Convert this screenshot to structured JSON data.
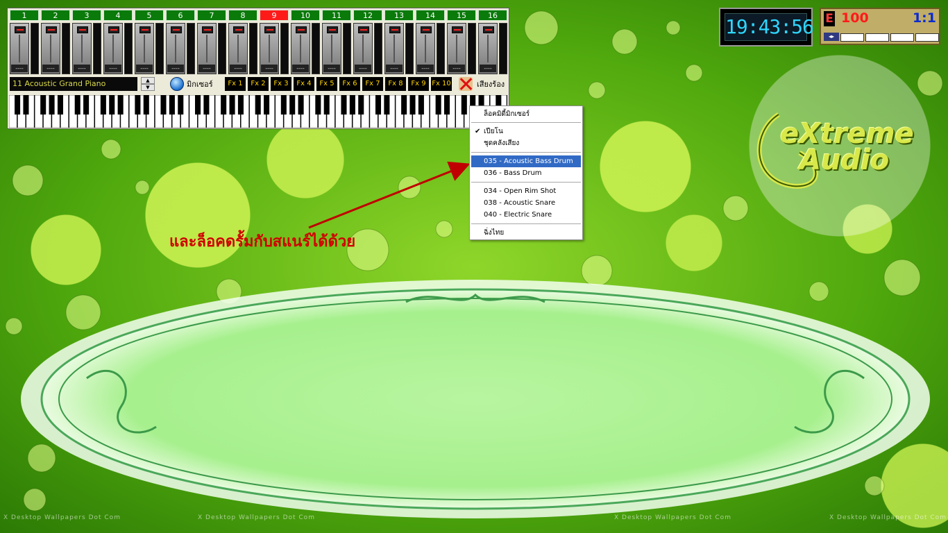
{
  "mixer": {
    "channels": [
      "1",
      "2",
      "3",
      "4",
      "5",
      "6",
      "7",
      "8",
      "9",
      "10",
      "11",
      "12",
      "13",
      "14",
      "15",
      "16"
    ],
    "active_channel": "9",
    "channel_value": "----",
    "instrument": "11 Acoustic Grand Piano",
    "spin_up": "▲",
    "spin_down": "▼",
    "mixer_label": "มิกเซอร์",
    "fx_buttons": [
      "Fx 1",
      "Fx 2",
      "Fx 3",
      "Fx 4",
      "Fx 5",
      "Fx 6",
      "Fx 7",
      "Fx 8",
      "Fx 9",
      "Fx 10"
    ],
    "vocal_label": "เสียงร้อง"
  },
  "clock": {
    "time": "19:43:56"
  },
  "status": {
    "mode_letter": "E",
    "volume": "100",
    "ratio": "1:1"
  },
  "context_menu": {
    "items": [
      "ล็อคมิดี้มิกเซอร์",
      "เปียโน",
      "ชุดคลังเสียง",
      "035 - Acoustic Bass Drum",
      "036 - Bass Drum",
      "034 - Open Rim Shot",
      "038 - Acoustic Snare",
      "040 - Electric Snare",
      "ฉิ่งไทย"
    ],
    "checked_item": "เปียโน",
    "highlighted_item": "035 - Acoustic Bass Drum",
    "highlight_color": "#316ac5"
  },
  "annotation": {
    "text": "และล็อคดรั้มกับสแนร์ได้ด้วย",
    "color": "#d00000"
  },
  "logo": {
    "line1": "eXtreme",
    "line2": "Audio"
  },
  "watermark": "X Desktop Wallpapers Dot Com",
  "colors": {
    "channel_green": "#0a7a0a",
    "channel_active": "#ff1a1a",
    "fx_text": "#ffd400",
    "clock_digits": "#2fd6ff"
  }
}
